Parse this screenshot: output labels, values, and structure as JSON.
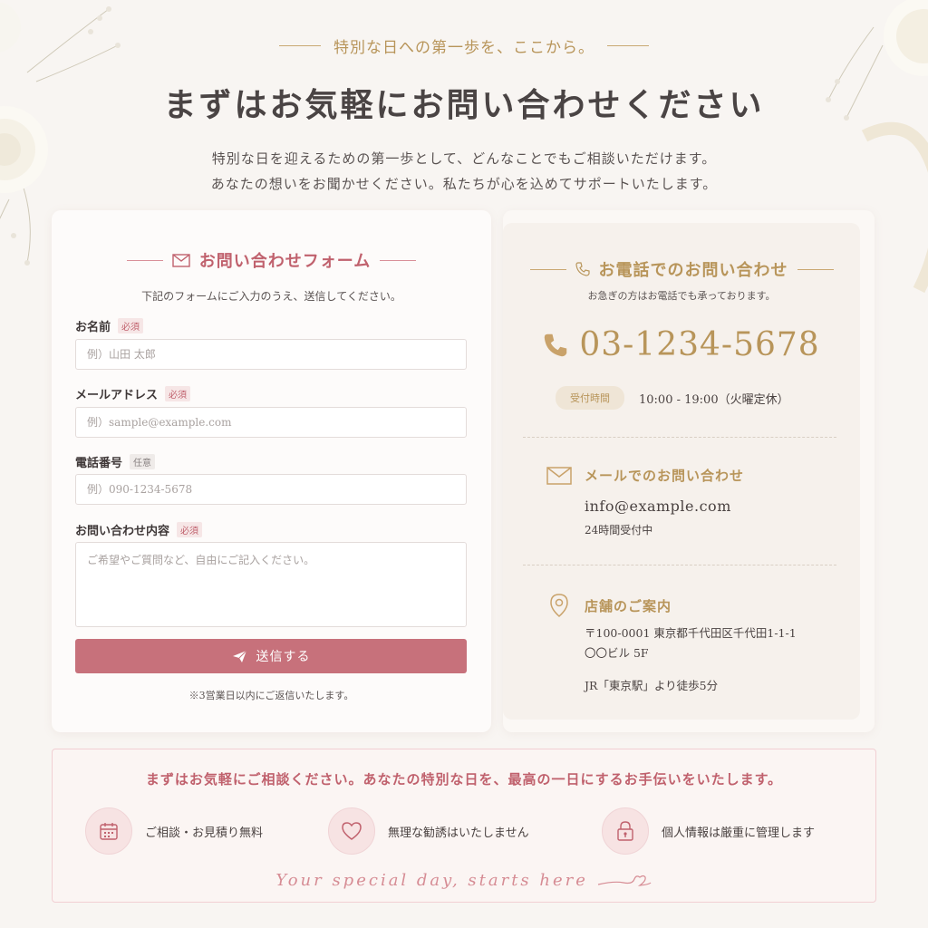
{
  "hero": {
    "eyebrow": "特別な日への第一歩を、ここから。",
    "title": "まずはお気軽にお問い合わせください",
    "lead_line1": "特別な日を迎えるための第一歩として、どんなことでもご相談いただけます。",
    "lead_line2": "あなたの想いをお聞かせください。私たちが心を込めてサポートいたします。"
  },
  "form": {
    "heading": "お問い合わせフォーム",
    "subtitle": "下記のフォームにご入力のうえ、送信してください。",
    "required_badge": "必須",
    "optional_badge": "任意",
    "name_label": "お名前",
    "name_placeholder": "例）山田 太郎",
    "email_label": "メールアドレス",
    "email_placeholder": "例）sample@example.com",
    "phone_label": "電話番号",
    "phone_placeholder": "例）090-1234-5678",
    "message_label": "お問い合わせ内容",
    "message_placeholder": "ご希望やご質問など、自由にご記入ください。",
    "submit_label": "送信する",
    "note": "※3営業日以内にご返信いたします。"
  },
  "contact": {
    "tel_heading": "お電話でのお問い合わせ",
    "tel_subtitle": "お急ぎの方はお電話でも承っております。",
    "tel_number": "03-1234-5678",
    "hours_badge": "受付時間",
    "hours_text": "10:00 - 19:00（火曜定休）",
    "mail_heading": "メールでのお問い合わせ",
    "mail_address": "info@example.com",
    "mail_note": "24時間受付中",
    "store_heading": "店舗のご案内",
    "store_address_line1": "〒100-0001 東京都千代田区千代田1-1-1",
    "store_address_line2": "〇〇ビル 5F",
    "store_access": "JR「東京駅」より徒歩5分"
  },
  "banner": {
    "lead": "まずはお気軽にご相談ください。あなたの特別な日を、最高の一日にするお手伝いをいたします。",
    "feature1": "ご相談・お見積り無料",
    "feature2": "無理な勧誘はいたしません",
    "feature3": "個人情報は厳重に管理します",
    "script": "Your special day, starts here"
  },
  "colors": {
    "accent_rose": "#c0616d",
    "accent_gold": "#b8955a",
    "button": "#c7717b",
    "background": "#f8f5f2"
  },
  "icons": [
    "mail-icon",
    "phone-icon",
    "send-icon",
    "location-pin-icon",
    "calendar-icon",
    "heart-icon",
    "lock-icon"
  ]
}
